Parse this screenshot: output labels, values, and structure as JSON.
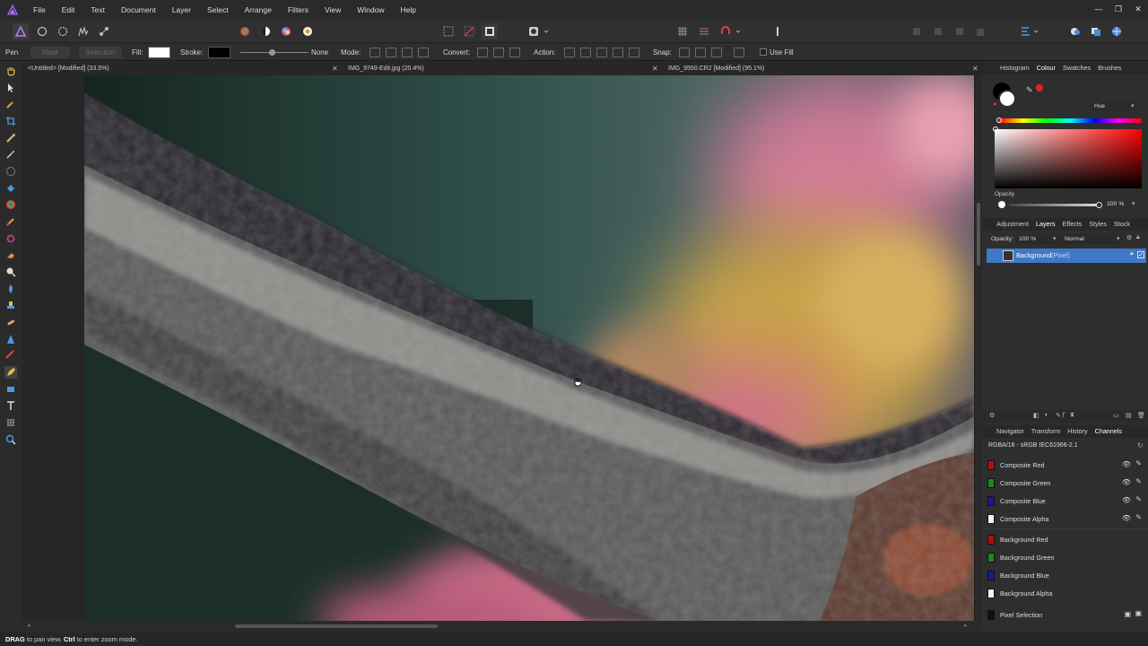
{
  "app": {
    "logo_icon": "affinity-photo-logo-icon"
  },
  "menu": [
    "File",
    "Edit",
    "Text",
    "Document",
    "Layer",
    "Select",
    "Arrange",
    "Filters",
    "View",
    "Window",
    "Help"
  ],
  "window_controls": [
    "—",
    "❐",
    "✕"
  ],
  "context_toolbar": {
    "tool_name": "Pen",
    "mask_label": "Mask",
    "selection_label": "Selection",
    "fill_label": "Fill:",
    "stroke_label": "Stroke:",
    "stroke_none": "None",
    "mode_label": "Mode:",
    "convert_label": "Convert:",
    "action_label": "Action:",
    "snap_label": "Snap:",
    "use_fill_label": "Use Fill",
    "fill_color": "#ffffff",
    "stroke_color": "#000000"
  },
  "tabs": [
    {
      "label": "<Untitled> [Modified] (33.5%)"
    },
    {
      "label": "IMG_9749-Edit.jpg (20.4%)"
    },
    {
      "label": "IMG_9550.CR2 [Modified] (95.1%)"
    }
  ],
  "colour_panel": {
    "tabs": [
      "Histogram",
      "Colour",
      "Swatches",
      "Brushes"
    ],
    "active_tab": "Colour",
    "mode_select": "Hue",
    "opacity_label": "Opacity",
    "opacity_value": "100 %",
    "opacity_fraction": 1.0,
    "accent_color": "#e0202a"
  },
  "layers_panel": {
    "tabs": [
      "Adjustment",
      "Layers",
      "Effects",
      "Styles",
      "Stock"
    ],
    "active_tab": "Layers",
    "opacity_label": "Opacity:",
    "opacity_value": "100 %",
    "blend_mode": "Normal",
    "layer_name": "Background",
    "layer_type": "(Pixel)",
    "selected_color": "#3f78c6"
  },
  "channels_panel": {
    "tabs": [
      "Navigator",
      "Transform",
      "History",
      "Channels"
    ],
    "active_tab": "Channels",
    "profile": "RGBA/16 - sRGB IEC61966-2.1",
    "composite": [
      {
        "label": "Composite Red",
        "color": "#b01010"
      },
      {
        "label": "Composite Green",
        "color": "#1a8a1a"
      },
      {
        "label": "Composite Blue",
        "color": "#1a1a9a"
      },
      {
        "label": "Composite Alpha",
        "color": "#f4f4f4"
      }
    ],
    "background": [
      {
        "label": "Background Red",
        "color": "#b01010"
      },
      {
        "label": "Background Green",
        "color": "#1a8a1a"
      },
      {
        "label": "Background Blue",
        "color": "#1a1a9a"
      },
      {
        "label": "Background Alpha",
        "color": "#f4f4f4"
      }
    ],
    "pixel_selection": {
      "label": "Pixel Selection",
      "color": "#111111"
    }
  },
  "status": {
    "key1": "DRAG",
    "text1": " to pan view. ",
    "key2": "Ctrl",
    "text2": " to enter zoom mode."
  }
}
